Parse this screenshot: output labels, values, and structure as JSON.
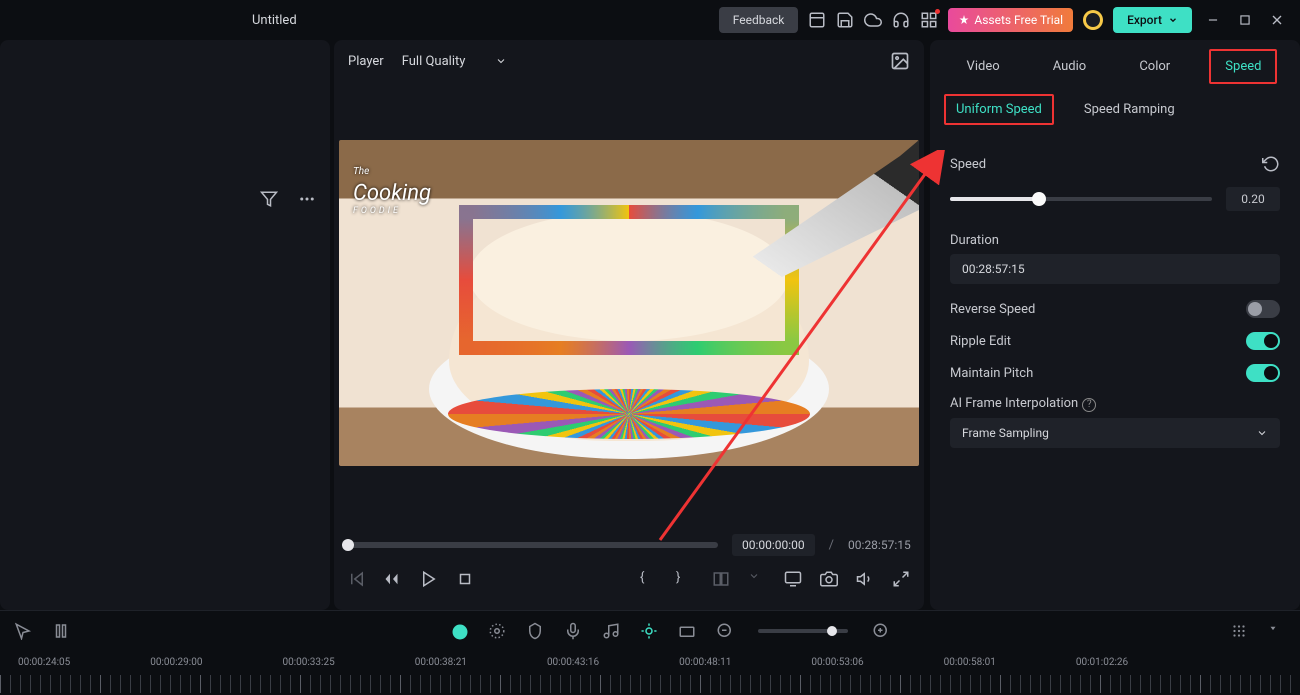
{
  "titlebar": {
    "title": "Untitled",
    "feedback": "Feedback",
    "assets_trial": "Assets Free Trial",
    "export": "Export"
  },
  "player": {
    "label": "Player",
    "quality": "Full Quality",
    "current_time": "00:00:00:00",
    "total_time": "00:28:57:15",
    "watermark_title": "Cooking",
    "watermark_sub": "FOODIE"
  },
  "right_panel": {
    "tabs": {
      "video": "Video",
      "audio": "Audio",
      "color": "Color",
      "speed": "Speed"
    },
    "sub_tabs": {
      "uniform": "Uniform Speed",
      "ramping": "Speed Ramping"
    },
    "speed_label": "Speed",
    "speed_value": "0.20",
    "duration_label": "Duration",
    "duration_value": "00:28:57:15",
    "reverse_label": "Reverse Speed",
    "ripple_label": "Ripple Edit",
    "pitch_label": "Maintain Pitch",
    "ai_interp_label": "AI Frame Interpolation",
    "ai_interp_value": "Frame Sampling"
  },
  "timeline": {
    "ticks": [
      "00:00:24:05",
      "00:00:29:00",
      "00:00:33:25",
      "00:00:38:21",
      "00:00:43:16",
      "00:00:48:11",
      "00:00:53:06",
      "00:00:58:01",
      "00:01:02:26"
    ]
  }
}
